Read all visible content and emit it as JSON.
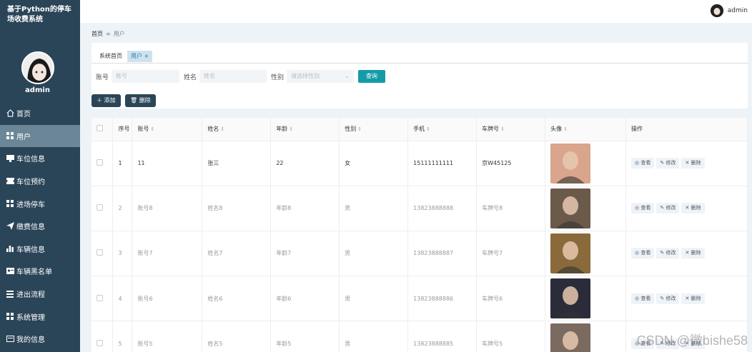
{
  "app": {
    "title": "基于Python的停车场收费系统"
  },
  "sidebar": {
    "username": "admin",
    "items": [
      {
        "label": "首页",
        "icon": "home-icon",
        "active": false
      },
      {
        "label": "用户",
        "icon": "grid-icon",
        "active": true
      },
      {
        "label": "车位信息",
        "icon": "monitor-icon",
        "active": false
      },
      {
        "label": "车位预约",
        "icon": "ticket-icon",
        "active": false
      },
      {
        "label": "进场停车",
        "icon": "grid-icon",
        "active": false
      },
      {
        "label": "缴费信息",
        "icon": "send-icon",
        "active": false
      },
      {
        "label": "车辆信息",
        "icon": "bar-chart-icon",
        "active": false
      },
      {
        "label": "车辆黑名单",
        "icon": "id-card-icon",
        "active": false
      },
      {
        "label": "进出流程",
        "icon": "list-icon",
        "active": false
      },
      {
        "label": "系统管理",
        "icon": "grid-icon",
        "active": false
      },
      {
        "label": "我的信息",
        "icon": "card-icon",
        "active": false
      }
    ]
  },
  "topbar": {
    "username": "admin"
  },
  "breadcrumb": {
    "home": "首页",
    "current": "用户"
  },
  "tabs": [
    {
      "label": "系统首页"
    },
    {
      "label": "用户",
      "close": "×"
    }
  ],
  "search": {
    "account_label": "账号",
    "account_placeholder": "账号",
    "name_label": "姓名",
    "name_placeholder": "姓名",
    "gender_label": "性别",
    "gender_placeholder": "请选择性别",
    "query_button": "查询"
  },
  "actions": {
    "add_label": "添加",
    "delete_label": "删除"
  },
  "table": {
    "headers": {
      "index": "序号",
      "account": "账号",
      "name": "姓名",
      "age": "年龄",
      "gender": "性别",
      "phone": "手机",
      "plate": "车牌号",
      "avatar": "头像",
      "ops": "操作"
    },
    "rows": [
      {
        "index": "1",
        "account": "11",
        "name": "张三",
        "age": "22",
        "gender": "女",
        "phone": "15111111111",
        "plate": "京W45125",
        "photo_color": "#d9a58c"
      },
      {
        "index": "2",
        "account": "账号8",
        "name": "姓名8",
        "age": "年龄8",
        "gender": "男",
        "phone": "13823888888",
        "plate": "车牌号8",
        "photo_color": "#6b5a4a"
      },
      {
        "index": "3",
        "account": "账号7",
        "name": "姓名7",
        "age": "年龄7",
        "gender": "男",
        "phone": "13823888887",
        "plate": "车牌号7",
        "photo_color": "#8a6a3a"
      },
      {
        "index": "4",
        "account": "账号6",
        "name": "姓名6",
        "age": "年龄6",
        "gender": "男",
        "phone": "13823888886",
        "plate": "车牌号6",
        "photo_color": "#2a2c3a"
      },
      {
        "index": "5",
        "account": "账号5",
        "name": "姓名5",
        "age": "年龄5",
        "gender": "男",
        "phone": "13823888885",
        "plate": "车牌号5",
        "photo_color": "#7a6a60"
      }
    ],
    "ops": {
      "view": "查看",
      "edit": "修改",
      "delete": "删除"
    }
  },
  "watermark": "CSDN @微bishe58",
  "colors": {
    "sidebar": "#2b4558",
    "active_menu": "#6b8797",
    "accent": "#159ba8"
  }
}
